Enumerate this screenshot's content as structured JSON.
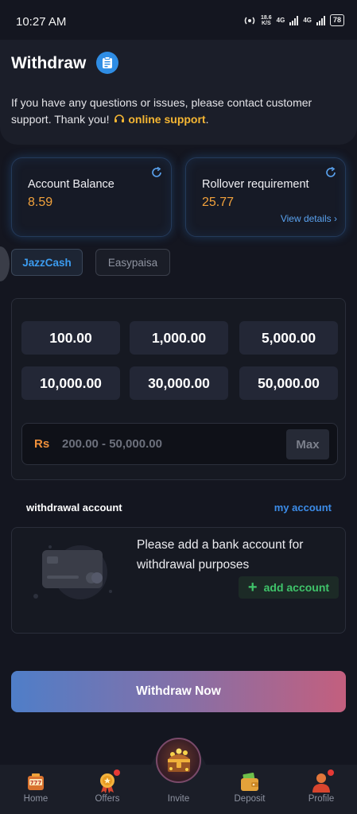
{
  "status_bar": {
    "time": "10:27 AM",
    "speed_value": "18.6",
    "speed_unit": "K/S",
    "net1": "4G",
    "net2": "4G",
    "battery": "78"
  },
  "header": {
    "title": "Withdraw",
    "title_icon": "clipboard-icon",
    "notice": "If you have any questions or issues, please contact customer support. Thank you!",
    "support_link": "online support",
    "support_suffix": "."
  },
  "balance_cards": {
    "account_balance_label": "Account Balance",
    "account_balance_value": "8.59",
    "rollover_label": "Rollover requirement",
    "rollover_value": "25.77",
    "view_details": "View details"
  },
  "methods": {
    "tabs": [
      "JazzCash",
      "Easypaisa"
    ],
    "selected": "JazzCash"
  },
  "amounts": {
    "presets": [
      "100.00",
      "1,000.00",
      "5,000.00",
      "10,000.00",
      "30,000.00",
      "50,000.00"
    ],
    "currency": "Rs",
    "placeholder_range": "200.00 - 50,000.00",
    "max_label": "Max"
  },
  "withdrawal_account": {
    "label": "withdrawal account",
    "my_account": "my account",
    "prompt": "Please add a bank account for withdrawal purposes",
    "add_label": "add account"
  },
  "actions": {
    "withdraw_now": "Withdraw Now"
  },
  "bottom_nav": {
    "items": [
      "Home",
      "Offers",
      "Invite",
      "Deposit",
      "Profile"
    ]
  },
  "colors": {
    "accent_blue": "#3c9cf0",
    "value_orange": "#f2a23c",
    "support_yellow": "#f5b633",
    "add_green": "#3fc46a"
  }
}
